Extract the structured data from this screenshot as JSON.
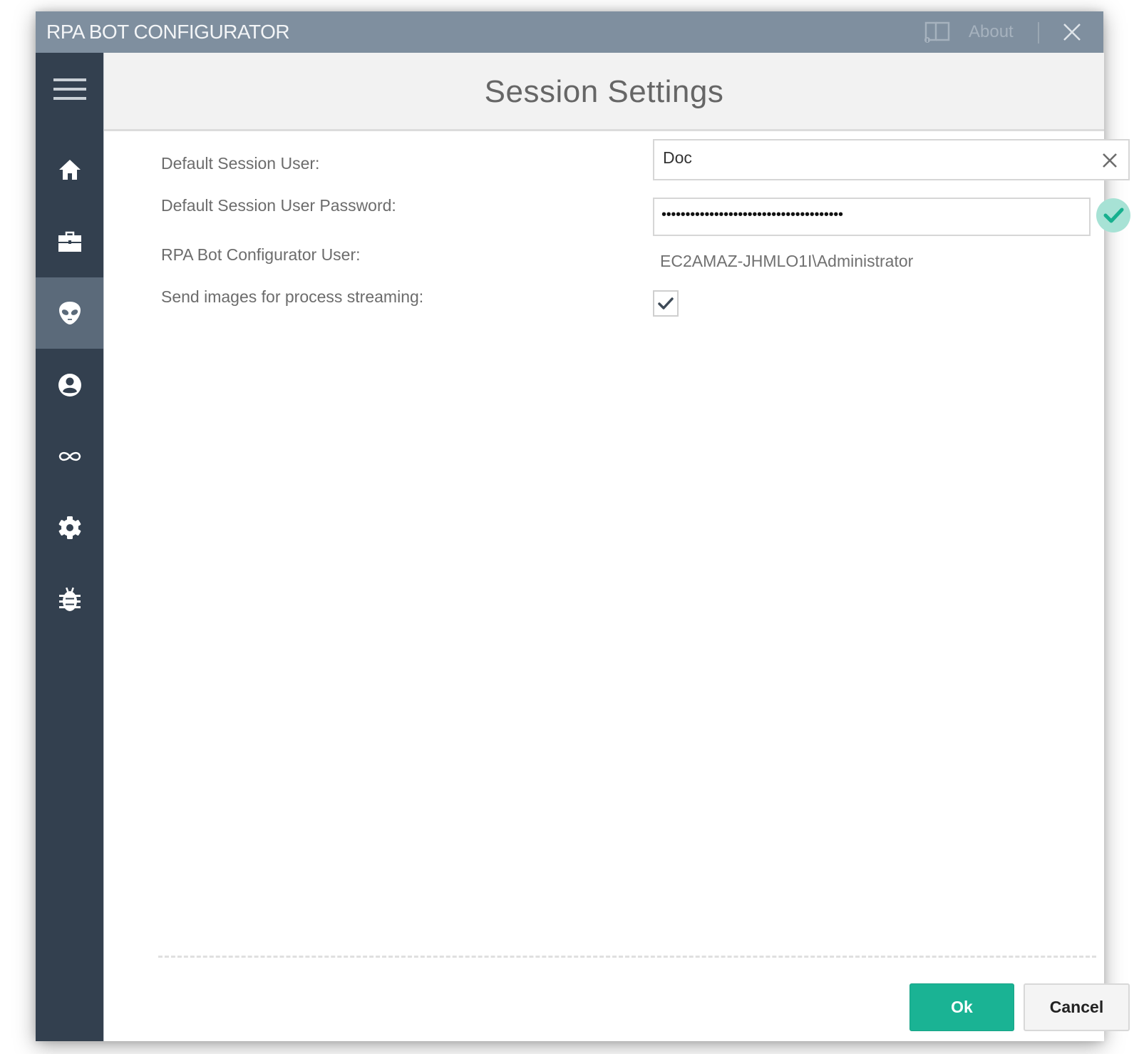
{
  "window": {
    "title": "RPA BOT CONFIGURATOR",
    "about_label": "About",
    "about_icon": "book-info-icon",
    "close_icon": "close-icon"
  },
  "sidebar": {
    "menu_icon": "hamburger-menu-icon",
    "items": [
      {
        "id": "home",
        "icon": "home-icon",
        "active": false
      },
      {
        "id": "briefcase",
        "icon": "briefcase-icon",
        "active": false
      },
      {
        "id": "session",
        "icon": "alien-icon",
        "active": true
      },
      {
        "id": "user",
        "icon": "user-circle-icon",
        "active": false
      },
      {
        "id": "infinity",
        "icon": "infinity-icon",
        "active": false
      },
      {
        "id": "settings",
        "icon": "gear-icon",
        "active": false
      },
      {
        "id": "debug",
        "icon": "bug-icon",
        "active": false
      }
    ]
  },
  "page": {
    "title": "Session Settings"
  },
  "form": {
    "default_user_label": "Default Session User:",
    "default_user_value": "Doc",
    "password_label": "Default Session User Password:",
    "password_value": "••••••••••••••••••••••••••••••••••••••",
    "password_valid": true,
    "configurator_user_label": "RPA Bot Configurator User:",
    "configurator_user_value": "EC2AMAZ-JHMLO1I\\Administrator",
    "send_images_label": "Send images for process streaming:",
    "send_images_checked": true
  },
  "buttons": {
    "ok": "Ok",
    "cancel": "Cancel"
  },
  "colors": {
    "titlebar": "#7f8f9f",
    "sidebar": "#33404f",
    "sidebar_active": "#5b6a7a",
    "accent": "#1ab394",
    "valid_bg": "#a7e2d5"
  }
}
